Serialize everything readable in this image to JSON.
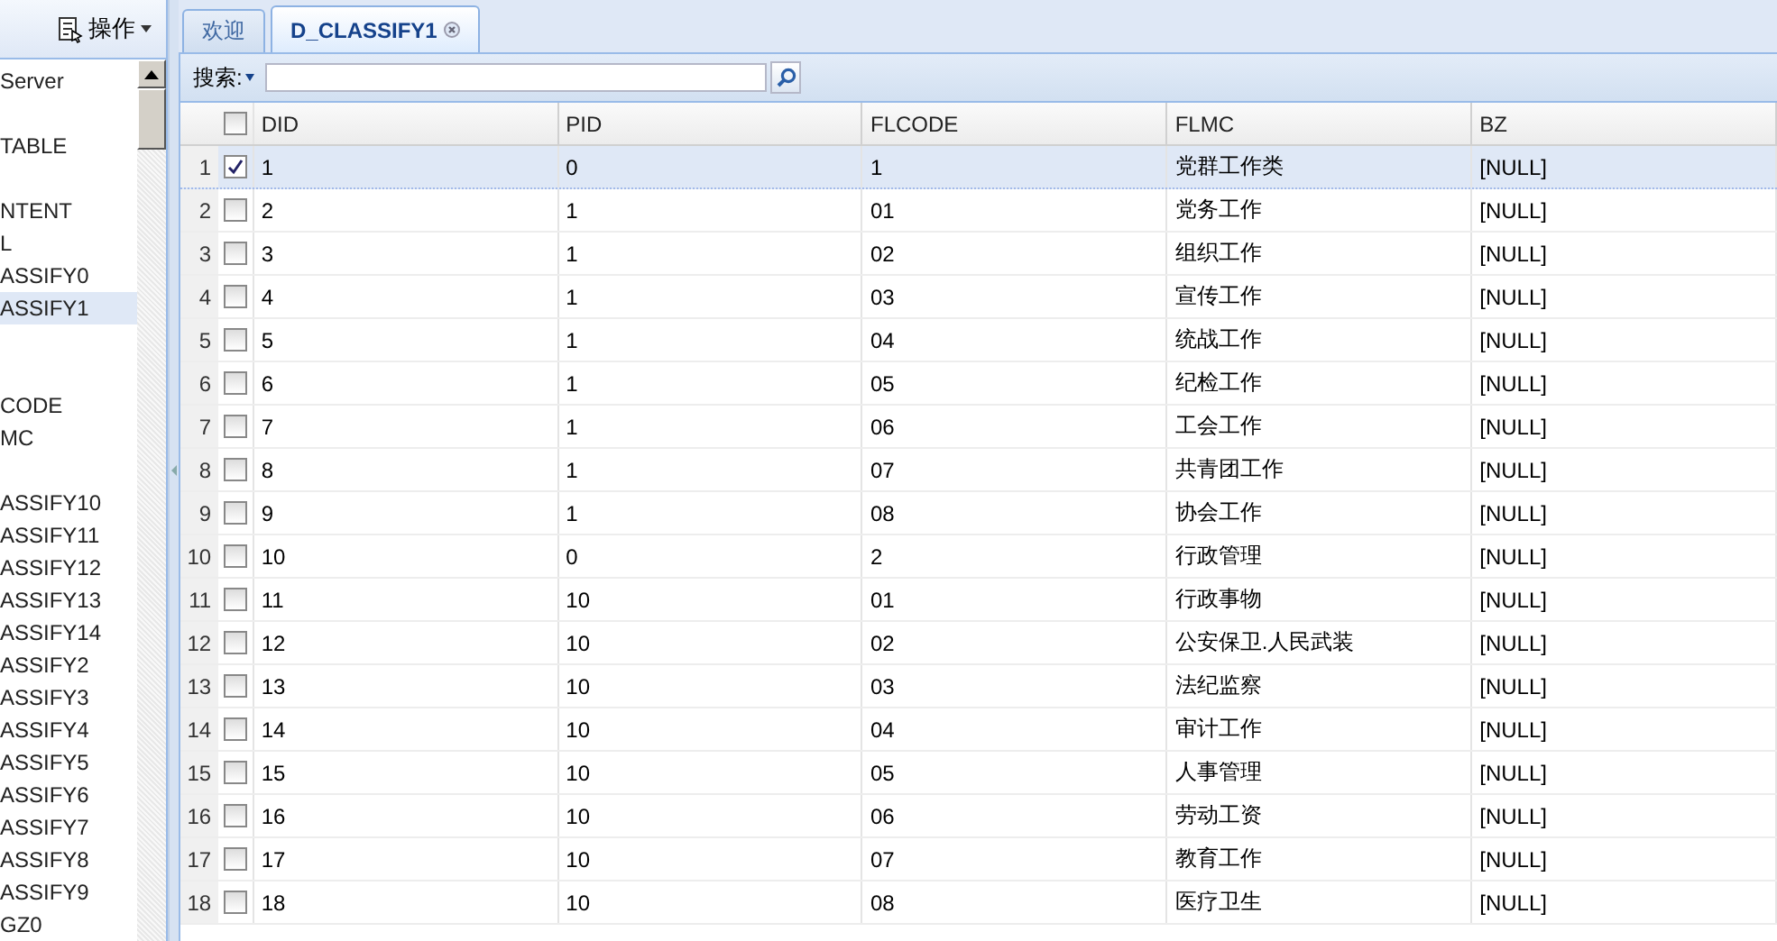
{
  "left_panel": {
    "action_button": "操作",
    "items": [
      {
        "label": "Server",
        "selected": false
      },
      {
        "selected": false
      },
      {
        "label": "TABLE",
        "selected": false
      },
      {
        "selected": false
      },
      {
        "label": "NTENT",
        "selected": false
      },
      {
        "label": "L",
        "selected": false
      },
      {
        "label": "ASSIFY0",
        "selected": false
      },
      {
        "label": "ASSIFY1",
        "selected": true
      },
      {
        "selected": false
      },
      {
        "selected": false
      },
      {
        "label": "CODE",
        "selected": false
      },
      {
        "label": "MC",
        "selected": false
      },
      {
        "selected": false
      },
      {
        "label": "ASSIFY10",
        "selected": false
      },
      {
        "label": "ASSIFY11",
        "selected": false
      },
      {
        "label": "ASSIFY12",
        "selected": false
      },
      {
        "label": "ASSIFY13",
        "selected": false
      },
      {
        "label": "ASSIFY14",
        "selected": false
      },
      {
        "label": "ASSIFY2",
        "selected": false
      },
      {
        "label": "ASSIFY3",
        "selected": false
      },
      {
        "label": "ASSIFY4",
        "selected": false
      },
      {
        "label": "ASSIFY5",
        "selected": false
      },
      {
        "label": "ASSIFY6",
        "selected": false
      },
      {
        "label": "ASSIFY7",
        "selected": false
      },
      {
        "label": "ASSIFY8",
        "selected": false
      },
      {
        "label": "ASSIFY9",
        "selected": false
      },
      {
        "label": "GZ0",
        "selected": false
      }
    ]
  },
  "tabs": [
    {
      "label": "欢迎",
      "selected": false,
      "closable": false
    },
    {
      "label": "D_CLASSIFY1",
      "selected": true,
      "closable": true
    }
  ],
  "search": {
    "label": "搜索:"
  },
  "table": {
    "header_checked": false,
    "columns": [
      "DID",
      "PID",
      "FLCODE",
      "FLMC",
      "BZ"
    ],
    "rows": [
      {
        "num": "1",
        "checked": true,
        "selected": true,
        "cells": [
          "1",
          "0",
          "1",
          "党群工作类",
          "[NULL]"
        ]
      },
      {
        "num": "2",
        "checked": false,
        "selected": false,
        "cells": [
          "2",
          "1",
          "01",
          "党务工作",
          "[NULL]"
        ]
      },
      {
        "num": "3",
        "checked": false,
        "selected": false,
        "cells": [
          "3",
          "1",
          "02",
          "组织工作",
          "[NULL]"
        ]
      },
      {
        "num": "4",
        "checked": false,
        "selected": false,
        "cells": [
          "4",
          "1",
          "03",
          "宣传工作",
          "[NULL]"
        ]
      },
      {
        "num": "5",
        "checked": false,
        "selected": false,
        "cells": [
          "5",
          "1",
          "04",
          "统战工作",
          "[NULL]"
        ]
      },
      {
        "num": "6",
        "checked": false,
        "selected": false,
        "cells": [
          "6",
          "1",
          "05",
          "纪检工作",
          "[NULL]"
        ]
      },
      {
        "num": "7",
        "checked": false,
        "selected": false,
        "cells": [
          "7",
          "1",
          "06",
          "工会工作",
          "[NULL]"
        ]
      },
      {
        "num": "8",
        "checked": false,
        "selected": false,
        "cells": [
          "8",
          "1",
          "07",
          "共青团工作",
          "[NULL]"
        ]
      },
      {
        "num": "9",
        "checked": false,
        "selected": false,
        "cells": [
          "9",
          "1",
          "08",
          "协会工作",
          "[NULL]"
        ]
      },
      {
        "num": "10",
        "checked": false,
        "selected": false,
        "cells": [
          "10",
          "0",
          "2",
          "行政管理",
          "[NULL]"
        ]
      },
      {
        "num": "11",
        "checked": false,
        "selected": false,
        "cells": [
          "11",
          "10",
          "01",
          "行政事物",
          "[NULL]"
        ]
      },
      {
        "num": "12",
        "checked": false,
        "selected": false,
        "cells": [
          "12",
          "10",
          "02",
          "公安保卫.人民武装",
          "[NULL]"
        ]
      },
      {
        "num": "13",
        "checked": false,
        "selected": false,
        "cells": [
          "13",
          "10",
          "03",
          "法纪监察",
          "[NULL]"
        ]
      },
      {
        "num": "14",
        "checked": false,
        "selected": false,
        "cells": [
          "14",
          "10",
          "04",
          "审计工作",
          "[NULL]"
        ]
      },
      {
        "num": "15",
        "checked": false,
        "selected": false,
        "cells": [
          "15",
          "10",
          "05",
          "人事管理",
          "[NULL]"
        ]
      },
      {
        "num": "16",
        "checked": false,
        "selected": false,
        "cells": [
          "16",
          "10",
          "06",
          "劳动工资",
          "[NULL]"
        ]
      },
      {
        "num": "17",
        "checked": false,
        "selected": false,
        "cells": [
          "17",
          "10",
          "07",
          "教育工作",
          "[NULL]"
        ]
      },
      {
        "num": "18",
        "checked": false,
        "selected": false,
        "cells": [
          "18",
          "10",
          "08",
          "医疗卫生",
          "[NULL]"
        ]
      }
    ]
  }
}
